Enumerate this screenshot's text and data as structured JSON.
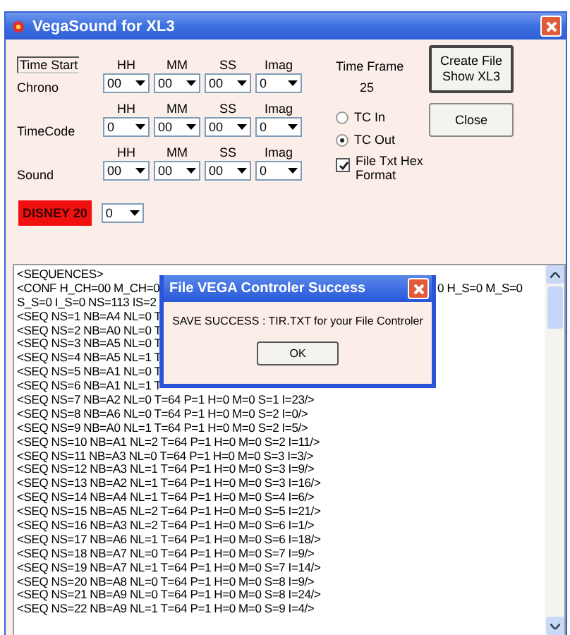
{
  "window": {
    "title": "VegaSound for XL3"
  },
  "time_start": "Time Start",
  "rows": [
    {
      "label": "Chrono",
      "fields": [
        {
          "header": "HH",
          "value": "00"
        },
        {
          "header": "MM",
          "value": "00"
        },
        {
          "header": "SS",
          "value": "00"
        },
        {
          "header": "Imag",
          "value": "0"
        }
      ]
    },
    {
      "label": "TimeCode",
      "fields": [
        {
          "header": "HH",
          "value": "0"
        },
        {
          "header": "MM",
          "value": "00"
        },
        {
          "header": "SS",
          "value": "00"
        },
        {
          "header": "Imag",
          "value": "0"
        }
      ]
    },
    {
      "label": "Sound",
      "fields": [
        {
          "header": "HH",
          "value": "00"
        },
        {
          "header": "MM",
          "value": "00"
        },
        {
          "header": "SS",
          "value": "00"
        },
        {
          "header": "Imag",
          "value": "0"
        }
      ]
    }
  ],
  "time_frame": {
    "label": "Time Frame",
    "value": "25"
  },
  "radios": [
    {
      "label": "TC In",
      "selected": false
    },
    {
      "label": "TC Out",
      "selected": true
    }
  ],
  "checkbox": {
    "label": "File Txt Hex Format",
    "checked": true
  },
  "buttons": [
    {
      "label": "Create File Show XL3",
      "selected": true
    },
    {
      "label": "Close",
      "selected": false
    }
  ],
  "badge": {
    "label": "DISNEY 20",
    "value": "0"
  },
  "log": [
    {
      "text": "<SEQUENCES>"
    },
    {
      "text": "<CONF H_CH=00 M_CH=0",
      "right": "0 H_S=0 M_S=0"
    },
    {
      "text": "S_S=0 I_S=0 NS=113 IS=2"
    },
    {
      "text": "<SEQ NS=1 NB=A4 NL=0 T"
    },
    {
      "text": "<SEQ NS=2 NB=A0 NL=0 T"
    },
    {
      "text": "<SEQ NS=3 NB=A5 NL=0 T"
    },
    {
      "text": "<SEQ NS=4 NB=A5 NL=1 T"
    },
    {
      "text": "<SEQ NS=5 NB=A1 NL=0 T"
    },
    {
      "text": "<SEQ NS=6 NB=A1 NL=1 T"
    },
    {
      "text": "<SEQ NS=7 NB=A2 NL=0 T=64 P=1 H=0 M=0 S=1 I=23/>"
    },
    {
      "text": "<SEQ NS=8 NB=A6 NL=0 T=64 P=1 H=0 M=0 S=2 I=0/>"
    },
    {
      "text": "<SEQ NS=9 NB=A0 NL=1 T=64 P=1 H=0 M=0 S=2 I=5/>"
    },
    {
      "text": "<SEQ NS=10 NB=A1 NL=2 T=64 P=1 H=0 M=0 S=2 I=11/>"
    },
    {
      "text": "<SEQ NS=11 NB=A3 NL=0 T=64 P=1 H=0 M=0 S=3 I=3/>"
    },
    {
      "text": "<SEQ NS=12 NB=A3 NL=1 T=64 P=1 H=0 M=0 S=3 I=9/>"
    },
    {
      "text": "<SEQ NS=13 NB=A2 NL=1 T=64 P=1 H=0 M=0 S=3 I=16/>"
    },
    {
      "text": "<SEQ NS=14 NB=A4 NL=1 T=64 P=1 H=0 M=0 S=4 I=6/>"
    },
    {
      "text": "<SEQ NS=15 NB=A5 NL=2 T=64 P=1 H=0 M=0 S=5 I=21/>"
    },
    {
      "text": "<SEQ NS=16 NB=A3 NL=2 T=64 P=1 H=0 M=0 S=6 I=1/>"
    },
    {
      "text": "<SEQ NS=17 NB=A6 NL=1 T=64 P=1 H=0 M=0 S=6 I=18/>"
    },
    {
      "text": "<SEQ NS=18 NB=A7 NL=0 T=64 P=1 H=0 M=0 S=7 I=9/>"
    },
    {
      "text": "<SEQ NS=19 NB=A7 NL=1 T=64 P=1 H=0 M=0 S=7 I=14/>"
    },
    {
      "text": "<SEQ NS=20 NB=A8 NL=0 T=64 P=1 H=0 M=0 S=8 I=9/>"
    },
    {
      "text": "<SEQ NS=21 NB=A9 NL=0 T=64 P=1 H=0 M=0 S=8 I=24/>"
    },
    {
      "text": "<SEQ NS=22 NB=A9 NL=1 T=64 P=1 H=0 M=0 S=9 I=4/>"
    }
  ],
  "dialog": {
    "title": "File VEGA Controler Success",
    "message": "SAVE SUCCESS : TIR.TXT  for your File Controler",
    "button": "OK"
  }
}
